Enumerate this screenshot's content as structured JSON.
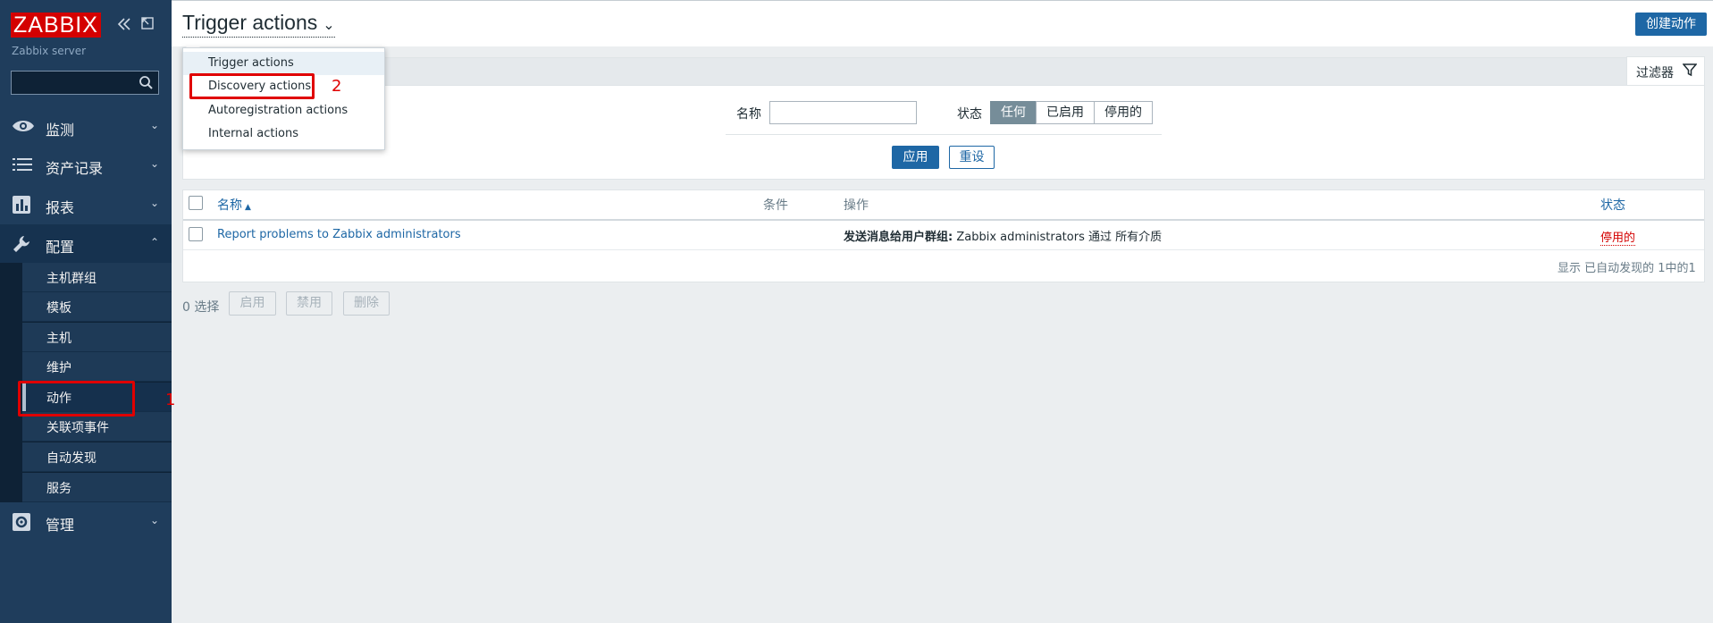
{
  "sidebar": {
    "logo_text": "ZABBIX",
    "server_name": "Zabbix server",
    "collapse_icon": "collapse-icon",
    "kiosk_icon": "expand-icon",
    "search_placeholder": "",
    "menu": [
      {
        "label": "监测",
        "icon": "eye-icon"
      },
      {
        "label": "资产记录",
        "icon": "list-icon"
      },
      {
        "label": "报表",
        "icon": "bar-chart-icon"
      },
      {
        "label": "配置",
        "icon": "wrench-icon"
      },
      {
        "label": "管理",
        "icon": "gear-icon"
      }
    ],
    "config_submenu": [
      "主机群组",
      "模板",
      "主机",
      "维护",
      "动作",
      "关联项事件",
      "自动发现",
      "服务"
    ],
    "active_submenu": "动作"
  },
  "header": {
    "title": "Trigger actions",
    "create_button": "创建动作"
  },
  "dropdown": {
    "items": [
      "Trigger actions",
      "Discovery actions",
      "Autoregistration actions",
      "Internal actions"
    ]
  },
  "filter": {
    "tab_label": "过滤器",
    "name_label": "名称",
    "name_value": "",
    "status_label": "状态",
    "status_options": [
      "任何",
      "已启用",
      "停用的"
    ],
    "status_selected": "任何",
    "apply": "应用",
    "reset": "重设"
  },
  "table": {
    "columns": [
      "名称",
      "条件",
      "操作",
      "状态"
    ],
    "sort_indicator": "▲",
    "rows": [
      {
        "name": "Report problems to Zabbix administrators",
        "conditions": "",
        "operation_bold": "发送消息给用户群组:",
        "operation_rest": " Zabbix administrators 通过 所有介质",
        "status": "停用的"
      }
    ],
    "footer": "显示 已自动发现的 1中的1"
  },
  "mass_actions": {
    "selected": "0 选择",
    "buttons": [
      "启用",
      "禁用",
      "删除"
    ]
  },
  "annotations": {
    "marker1": "1",
    "marker2": "2",
    "color": "#e00000"
  }
}
